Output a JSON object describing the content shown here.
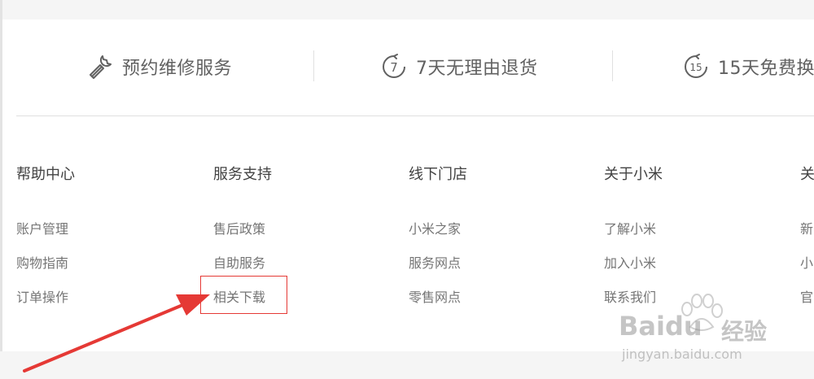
{
  "services": [
    {
      "icon": "wrench-icon",
      "label": "预约维修服务"
    },
    {
      "icon": "seven-day-circle-icon",
      "icon_text": "7",
      "label": "7天无理由退货"
    },
    {
      "icon": "fifteen-day-circle-icon",
      "icon_text": "15",
      "label": "15天免费换"
    }
  ],
  "footer": {
    "columns": [
      {
        "title": "帮助中心",
        "links": [
          "账户管理",
          "购物指南",
          "订单操作"
        ]
      },
      {
        "title": "服务支持",
        "links": [
          "售后政策",
          "自助服务",
          "相关下载"
        ]
      },
      {
        "title": "线下门店",
        "links": [
          "小米之家",
          "服务网点",
          "零售网点"
        ]
      },
      {
        "title": "关于小米",
        "links": [
          "了解小米",
          "加入小米",
          "联系我们"
        ]
      },
      {
        "title": "关",
        "links": [
          "新",
          "小",
          "官"
        ]
      }
    ]
  },
  "annotation": {
    "highlight_color": "#e53935",
    "arrow_color": "#e53935"
  },
  "watermark": {
    "brand": "Baidu",
    "brand_cn": "经验",
    "url": "jingyan.baidu.com"
  },
  "colors": {
    "top_bar": "#f5f5f5",
    "divider": "#e0e0e0",
    "link": "#757575",
    "heading": "#424242"
  }
}
